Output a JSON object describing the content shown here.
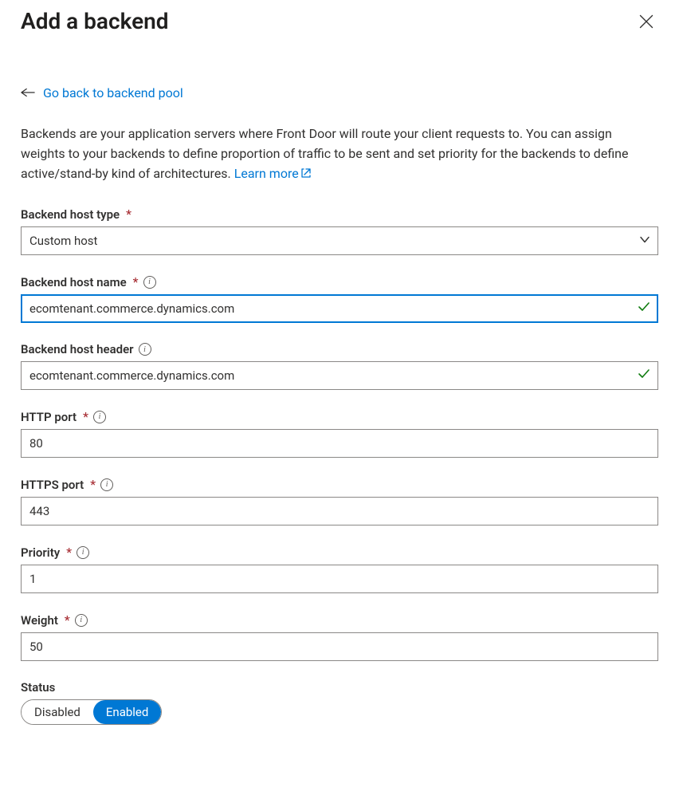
{
  "header": {
    "title": "Add a backend"
  },
  "back": {
    "label": "Go back to backend pool"
  },
  "description": {
    "text": "Backends are your application servers where Front Door will route your client requests to. You can assign weights to your backends to define proportion of traffic to be sent and set priority for the backends to define active/stand-by kind of architectures. ",
    "learn_more": "Learn more"
  },
  "fields": {
    "host_type": {
      "label": "Backend host type",
      "value": "Custom host"
    },
    "host_name": {
      "label": "Backend host name",
      "value": "ecomtenant.commerce.dynamics.com"
    },
    "host_header": {
      "label": "Backend host header",
      "value": "ecomtenant.commerce.dynamics.com"
    },
    "http_port": {
      "label": "HTTP port",
      "value": "80"
    },
    "https_port": {
      "label": "HTTPS port",
      "value": "443"
    },
    "priority": {
      "label": "Priority",
      "value": "1"
    },
    "weight": {
      "label": "Weight",
      "value": "50"
    },
    "status": {
      "label": "Status",
      "disabled": "Disabled",
      "enabled": "Enabled"
    }
  }
}
